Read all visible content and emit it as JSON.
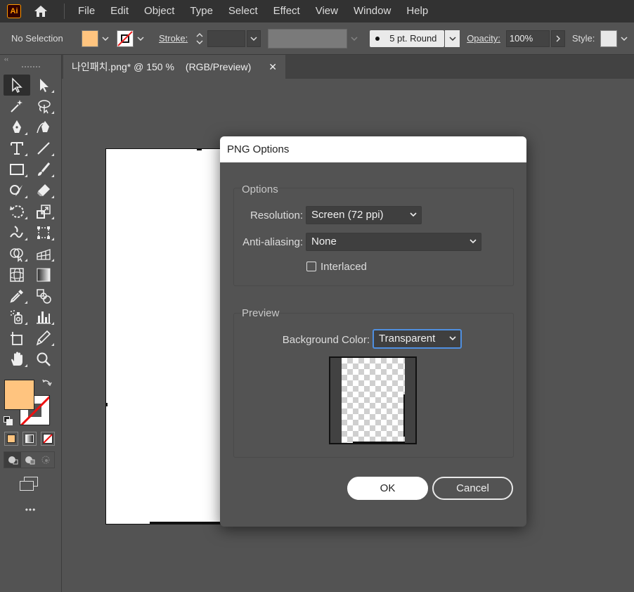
{
  "app": {
    "logo": "Ai"
  },
  "menubar": {
    "items": [
      "File",
      "Edit",
      "Object",
      "Type",
      "Select",
      "Effect",
      "View",
      "Window",
      "Help"
    ]
  },
  "control": {
    "selection": "No Selection",
    "fill_color": "#ffc47f",
    "stroke_label": "Stroke:",
    "brush": "5 pt. Round",
    "opacity_label": "Opacity:",
    "opacity": "100%",
    "style_label": "Style:"
  },
  "document": {
    "tab_title": "나인패치.png* @ 150 %",
    "tab_mode": "(RGB/Preview)",
    "close": "✕"
  },
  "toolbar": {
    "collapse": "‹‹",
    "more": "•••"
  },
  "dialog": {
    "title": "PNG Options",
    "options_group": "Options",
    "resolution_label": "Resolution:",
    "resolution_value": "Screen (72 ppi)",
    "antialias_label": "Anti-aliasing:",
    "antialias_value": "None",
    "interlaced_label": "Interlaced",
    "interlaced_checked": false,
    "preview_group": "Preview",
    "bg_label": "Background Color:",
    "bg_value": "Transparent",
    "ok": "OK",
    "cancel": "Cancel"
  }
}
